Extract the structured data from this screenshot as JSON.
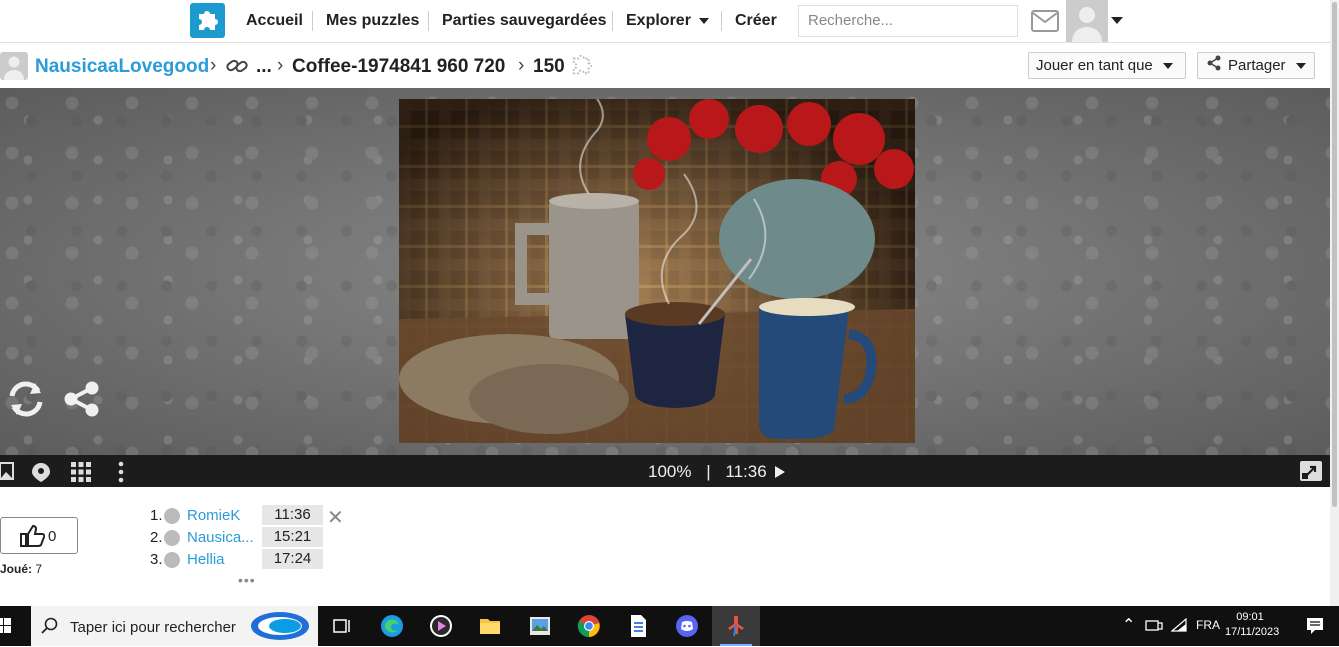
{
  "nav": {
    "home": "Accueil",
    "my_puzzles": "Mes puzzles",
    "saved_games": "Parties sauvegardées",
    "explore": "Explorer",
    "create": "Créer",
    "search_placeholder": "Recherche..."
  },
  "breadcrumb": {
    "user": "NausicaaLovegood",
    "ellipsis": "...",
    "puzzle_name": "Coffee-1974841 960 720",
    "pieces": "150",
    "play_as": "Jouer en tant que",
    "share": "Partager"
  },
  "controls": {
    "zoom": "100%",
    "separator": "|",
    "time": "11:36"
  },
  "likes": {
    "count": "0",
    "played_label": "Joué:",
    "played_count": "7"
  },
  "leaderboard": [
    {
      "rank": "1.",
      "name": "RomieK",
      "time": "11:36"
    },
    {
      "rank": "2.",
      "name": "Nausica...",
      "time": "15:21"
    },
    {
      "rank": "3.",
      "name": "Hellia",
      "time": "17:24"
    }
  ],
  "leaderboard_more": "•••",
  "taskbar": {
    "search_placeholder": "Taper ici pour rechercher",
    "lang": "FRA",
    "time": "09:01",
    "date": "17/11/2023"
  },
  "colors": {
    "accent": "#2b9cd8",
    "logo": "#1d9bd1",
    "control_bar": "#1c1c1c",
    "taskbar": "#101010"
  }
}
